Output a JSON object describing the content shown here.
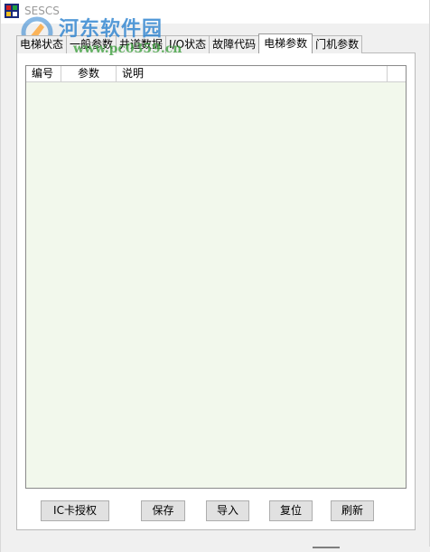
{
  "window": {
    "title": "SESCS"
  },
  "watermark": {
    "name": "河东软件园",
    "url": "www.pc0359.cn"
  },
  "tabs": [
    {
      "label": "电梯状态",
      "active": false
    },
    {
      "label": "一般参数",
      "active": false
    },
    {
      "label": "井道数据",
      "active": false
    },
    {
      "label": "I/O状态",
      "active": false
    },
    {
      "label": "故障代码",
      "active": false
    },
    {
      "label": "电梯参数",
      "active": true
    },
    {
      "label": "门机参数",
      "active": false
    }
  ],
  "table": {
    "columns": [
      "编号",
      "参数",
      "说明",
      ""
    ],
    "rows": []
  },
  "buttons": {
    "ic_auth": "IC卡授权",
    "save": "保存",
    "import": "导入",
    "reset": "复位",
    "refresh": "刷新"
  },
  "colors": {
    "list_background": "#f2f8ec",
    "watermark_blue": "#247ecd",
    "watermark_green": "#40a040"
  }
}
